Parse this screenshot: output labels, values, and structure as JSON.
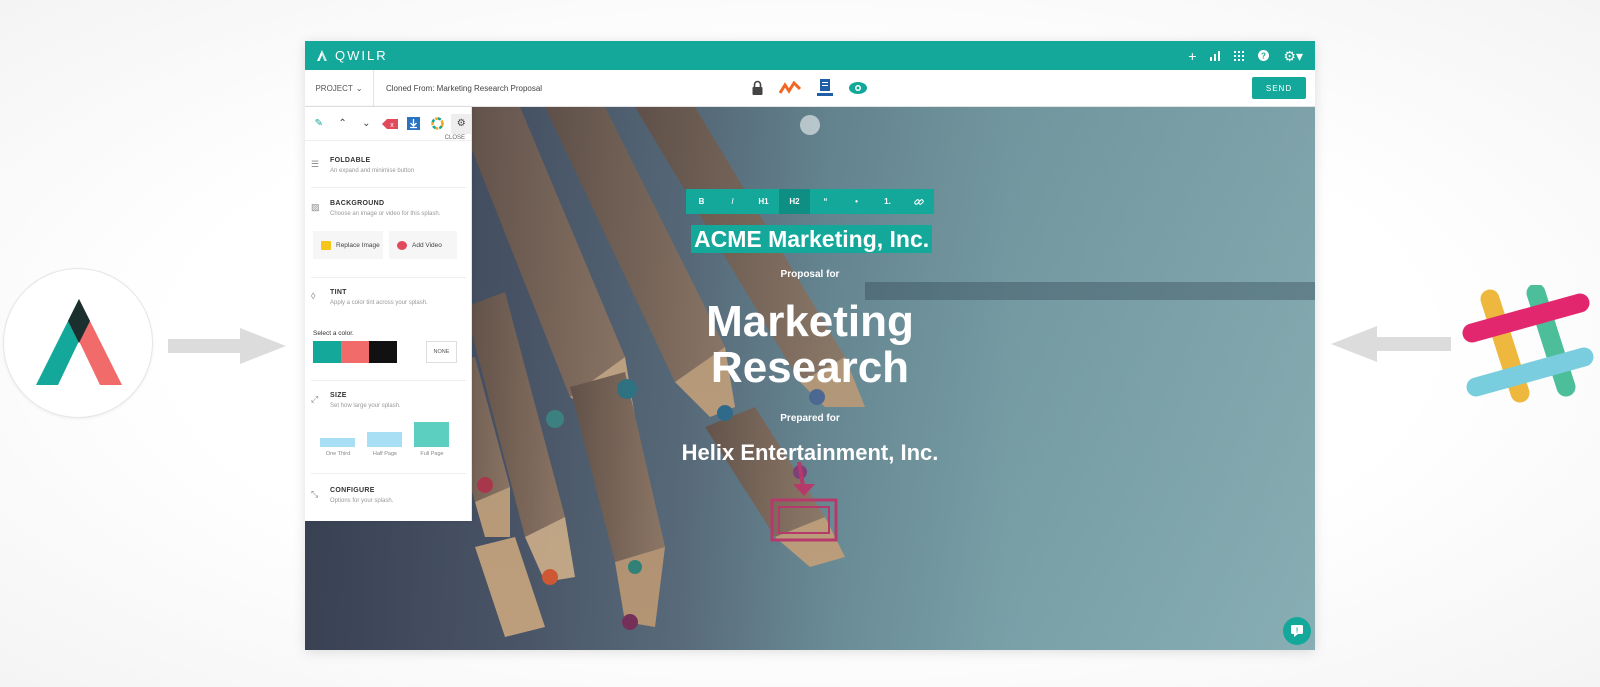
{
  "app": {
    "brand": "QWILR",
    "topbar_icons": [
      "plus-icon",
      "stats-icon",
      "grid-icon",
      "help-icon",
      "gear-icon"
    ],
    "accent": "#14a89b"
  },
  "toolbar": {
    "project_label": "PROJECT",
    "cloned_from": "Cloned From: Marketing Research Proposal",
    "send_label": "SEND",
    "center_icons": [
      "lock-icon",
      "activity-icon",
      "document-icon",
      "eye-icon"
    ]
  },
  "formatting": {
    "buttons": [
      "B",
      "I",
      "H1",
      "H2",
      "“",
      "•",
      "1.",
      "🔗"
    ],
    "active": "H2"
  },
  "hero": {
    "company": "ACME Marketing, Inc.",
    "proposal_for": "Proposal for",
    "title_line1": "Marketing",
    "title_line2": "Research",
    "prepared_for": "Prepared for",
    "client": "Helix Entertainment, Inc."
  },
  "panel": {
    "close_label": "CLOSE",
    "foldable": {
      "title": "FOLDABLE",
      "desc": "An expand and minimise button"
    },
    "background": {
      "title": "BACKGROUND",
      "desc": "Choose an image or video for this splash."
    },
    "replace_image": "Replace Image",
    "add_video": "Add Video",
    "tint": {
      "title": "TINT",
      "desc": "Apply a color tint across your splash."
    },
    "select_color": "Select a color.",
    "colors": [
      "#14a89b",
      "#f26b6b",
      "#111111",
      "#ffffff"
    ],
    "none_label": "NONE",
    "size": {
      "title": "SIZE",
      "desc": "Set how large your splash."
    },
    "size_options": [
      "One Third",
      "Half Page",
      "Full Page"
    ],
    "configure": {
      "title": "CONFIGURE",
      "desc": "Options for your splash."
    }
  }
}
